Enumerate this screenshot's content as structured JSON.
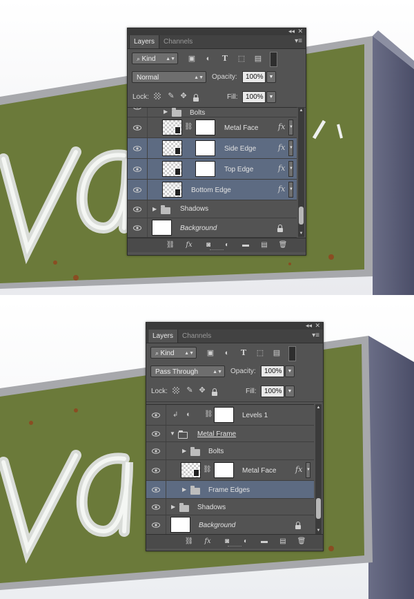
{
  "panel1": {
    "tabs": [
      "Layers",
      "Channels"
    ],
    "filter_kind": "Kind",
    "blend_mode": "Normal",
    "opacity_label": "Opacity:",
    "opacity_value": "100%",
    "lock_label": "Lock:",
    "fill_label": "Fill:",
    "fill_value": "100%",
    "layers": [
      {
        "name": "Bolts",
        "kind": "group",
        "selected": false
      },
      {
        "name": "Metal Face",
        "kind": "smart-masked",
        "fx": true,
        "selected": false
      },
      {
        "name": "Side Edge",
        "kind": "smart-masked",
        "fx": true,
        "selected": true
      },
      {
        "name": "Top Edge",
        "kind": "smart-masked",
        "fx": true,
        "selected": true
      },
      {
        "name": "Bottom Edge",
        "kind": "smart",
        "fx": true,
        "selected": true
      },
      {
        "name": "Shadows",
        "kind": "group",
        "selected": false
      },
      {
        "name": "Background",
        "kind": "background",
        "selected": false
      }
    ]
  },
  "panel2": {
    "tabs": [
      "Layers",
      "Channels"
    ],
    "filter_kind": "Kind",
    "blend_mode": "Pass Through",
    "opacity_label": "Opacity:",
    "opacity_value": "100%",
    "lock_label": "Lock:",
    "fill_label": "Fill:",
    "fill_value": "100%",
    "layers": [
      {
        "name": "Levels 1",
        "kind": "adjustment",
        "selected": false
      },
      {
        "name": "Metal Frame",
        "kind": "group-open",
        "selected": false
      },
      {
        "name": "Bolts",
        "kind": "group-nested",
        "selected": false
      },
      {
        "name": "Metal Face",
        "kind": "smart-masked",
        "fx": true,
        "selected": false
      },
      {
        "name": "Frame Edges",
        "kind": "group-nested",
        "selected": true
      },
      {
        "name": "Shadows",
        "kind": "group",
        "selected": false
      },
      {
        "name": "Background",
        "kind": "background",
        "selected": false
      }
    ]
  },
  "icons": {
    "filters": [
      "image-filter-icon",
      "adjustment-filter-icon",
      "type-filter-icon",
      "shape-filter-icon",
      "smart-object-filter-icon",
      "filter-toggle-icon"
    ],
    "locks": [
      "lock-transparent-icon",
      "lock-image-icon",
      "lock-position-icon",
      "lock-all-icon"
    ],
    "footer": [
      "link-layers-icon",
      "fx-icon",
      "add-mask-icon",
      "new-adjustment-icon",
      "new-group-icon",
      "new-layer-icon",
      "delete-icon"
    ]
  },
  "colors": {
    "panel_bg": "#535353",
    "selected_row": "#5d6b82",
    "sign_green": "#6b7a3a",
    "sign_frame": "#9ea0a6"
  }
}
